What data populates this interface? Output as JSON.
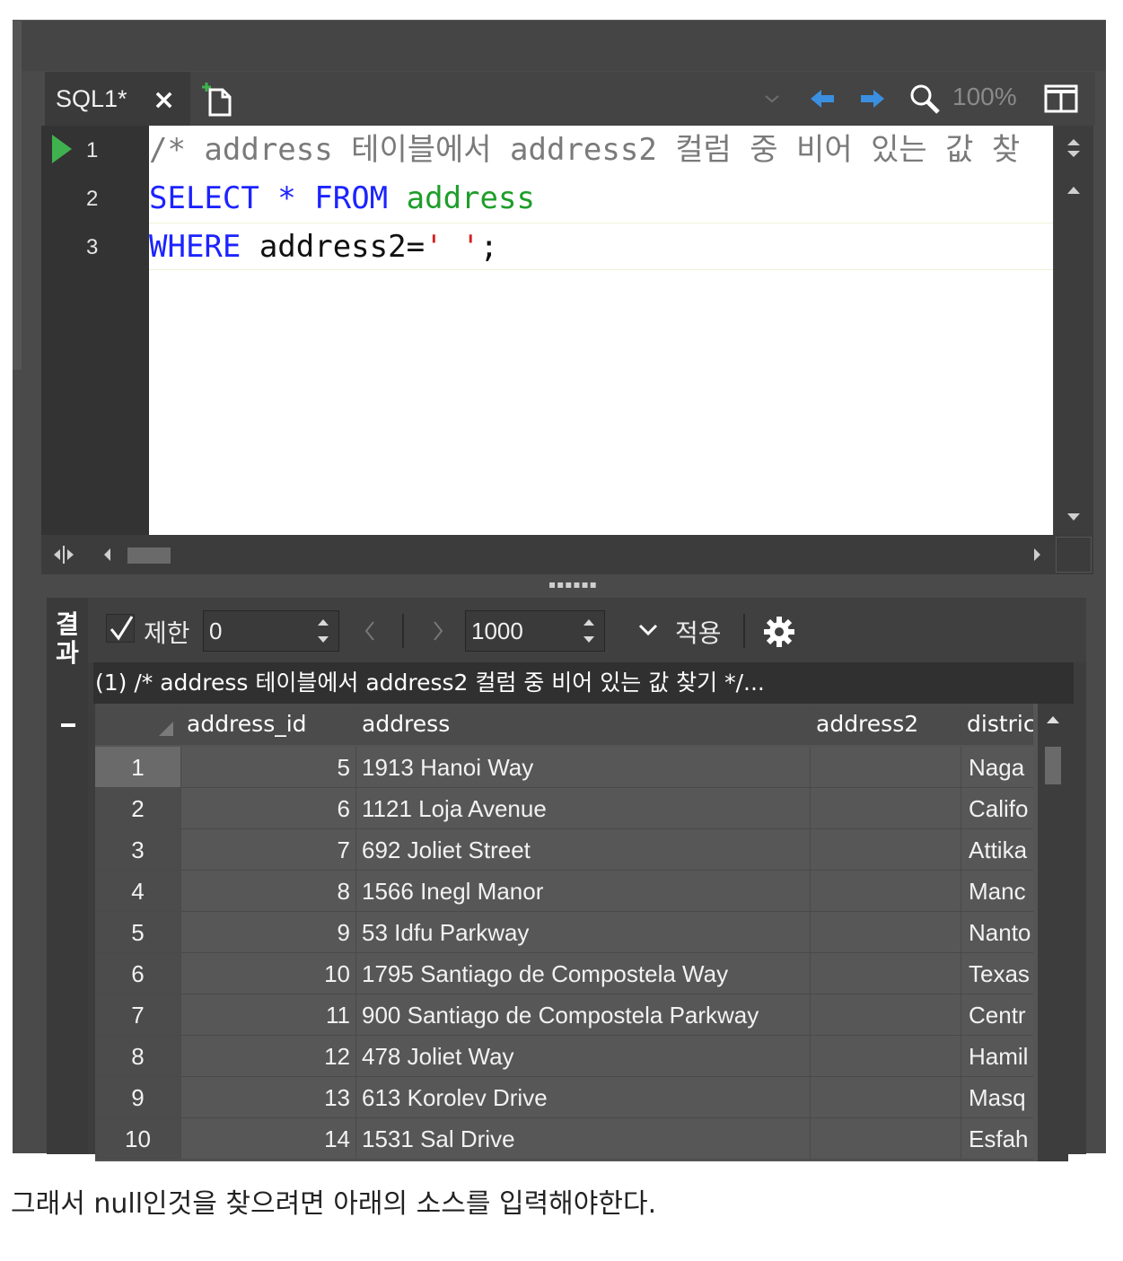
{
  "tabs": [
    {
      "label": "SQL1*",
      "close": "×"
    }
  ],
  "toolbar": {
    "zoom": "100%"
  },
  "editor": {
    "line_numbers": [
      "1",
      "2",
      "3"
    ],
    "lines": [
      [
        {
          "t": "/* address 테이블에서 address2 컬럼 중 비어 있는 값 ",
          "c": "cmt"
        },
        {
          "t": "찾",
          "c": "cmt"
        }
      ],
      [
        {
          "t": "SELECT",
          "c": "kw"
        },
        {
          "t": " * ",
          "c": "kw"
        },
        {
          "t": "FROM",
          "c": "kw"
        },
        {
          "t": " ",
          "c": "plain"
        },
        {
          "t": "address",
          "c": "tbl"
        }
      ],
      [
        {
          "t": "WHERE",
          "c": "kw"
        },
        {
          "t": " address2=",
          "c": "plain"
        },
        {
          "t": "' '",
          "c": "str"
        },
        {
          "t": ";",
          "c": "plain"
        }
      ]
    ]
  },
  "results": {
    "side_label": "결과",
    "limit_label": "제한",
    "limit_checked": true,
    "offset_value": "0",
    "count_value": "1000",
    "apply_label": "적용",
    "query_preview": "(1) /* address 테이블에서 address2 컬럼 중 비어 있는 값 찾기 */...",
    "columns": [
      "address_id",
      "address",
      "address2",
      "districi"
    ],
    "rows": [
      {
        "n": "1",
        "id": "5",
        "address": "1913 Hanoi Way",
        "address2": "",
        "district": "Naga"
      },
      {
        "n": "2",
        "id": "6",
        "address": "1121 Loja Avenue",
        "address2": "",
        "district": "Califo"
      },
      {
        "n": "3",
        "id": "7",
        "address": "692 Joliet Street",
        "address2": "",
        "district": "Attika"
      },
      {
        "n": "4",
        "id": "8",
        "address": "1566 Inegl Manor",
        "address2": "",
        "district": "Manc"
      },
      {
        "n": "5",
        "id": "9",
        "address": "53 Idfu Parkway",
        "address2": "",
        "district": "Nanto"
      },
      {
        "n": "6",
        "id": "10",
        "address": "1795 Santiago de Compostela Way",
        "address2": "",
        "district": "Texas"
      },
      {
        "n": "7",
        "id": "11",
        "address": "900 Santiago de Compostela Parkway",
        "address2": "",
        "district": "Centr"
      },
      {
        "n": "8",
        "id": "12",
        "address": "478 Joliet Way",
        "address2": "",
        "district": "Hamil"
      },
      {
        "n": "9",
        "id": "13",
        "address": "613 Korolev Drive",
        "address2": "",
        "district": "Masq"
      },
      {
        "n": "10",
        "id": "14",
        "address": "1531 Sal Drive",
        "address2": "",
        "district": "Esfah"
      }
    ]
  },
  "caption": "그래서 null인것을 찾으려면 아래의 소스를 입력해야한다.",
  "colors": {
    "keyword": "#1c23ff",
    "table": "#1e9e2a",
    "comment": "#7a7a7a",
    "string": "#d42020",
    "nav_arrow": "#3b8fe0",
    "run": "#3fb24f"
  }
}
